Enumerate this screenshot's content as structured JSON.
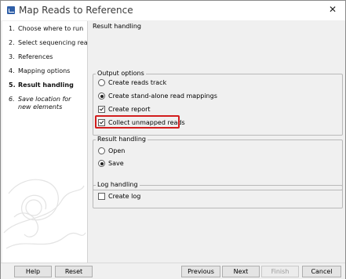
{
  "window": {
    "title": "Map Reads to Reference",
    "close_label": "✕"
  },
  "steps": [
    {
      "num": "1.",
      "label": "Choose where to run"
    },
    {
      "num": "2.",
      "label": "Select sequencing reads"
    },
    {
      "num": "3.",
      "label": "References"
    },
    {
      "num": "4.",
      "label": "Mapping options"
    },
    {
      "num": "5.",
      "label": "Result handling"
    },
    {
      "num": "6.",
      "label": "Save location for new elements"
    }
  ],
  "content": {
    "section_title": "Result handling",
    "output_options": {
      "title": "Output options",
      "create_reads_track": "Create reads track",
      "create_standalone": "Create stand-alone read mappings",
      "create_report": "Create report",
      "collect_unmapped": "Collect unmapped reads"
    },
    "result_handling": {
      "title": "Result handling",
      "open": "Open",
      "save": "Save"
    },
    "log_handling": {
      "title": "Log handling",
      "create_log": "Create log"
    }
  },
  "buttons": {
    "help": "Help",
    "reset": "Reset",
    "previous": "Previous",
    "next": "Next",
    "finish": "Finish",
    "cancel": "Cancel"
  },
  "colors": {
    "highlight": "#d21d1d",
    "app_icon": "#2f5fa8"
  },
  "icons": {
    "app": "app-logo-icon",
    "close": "close-icon"
  }
}
